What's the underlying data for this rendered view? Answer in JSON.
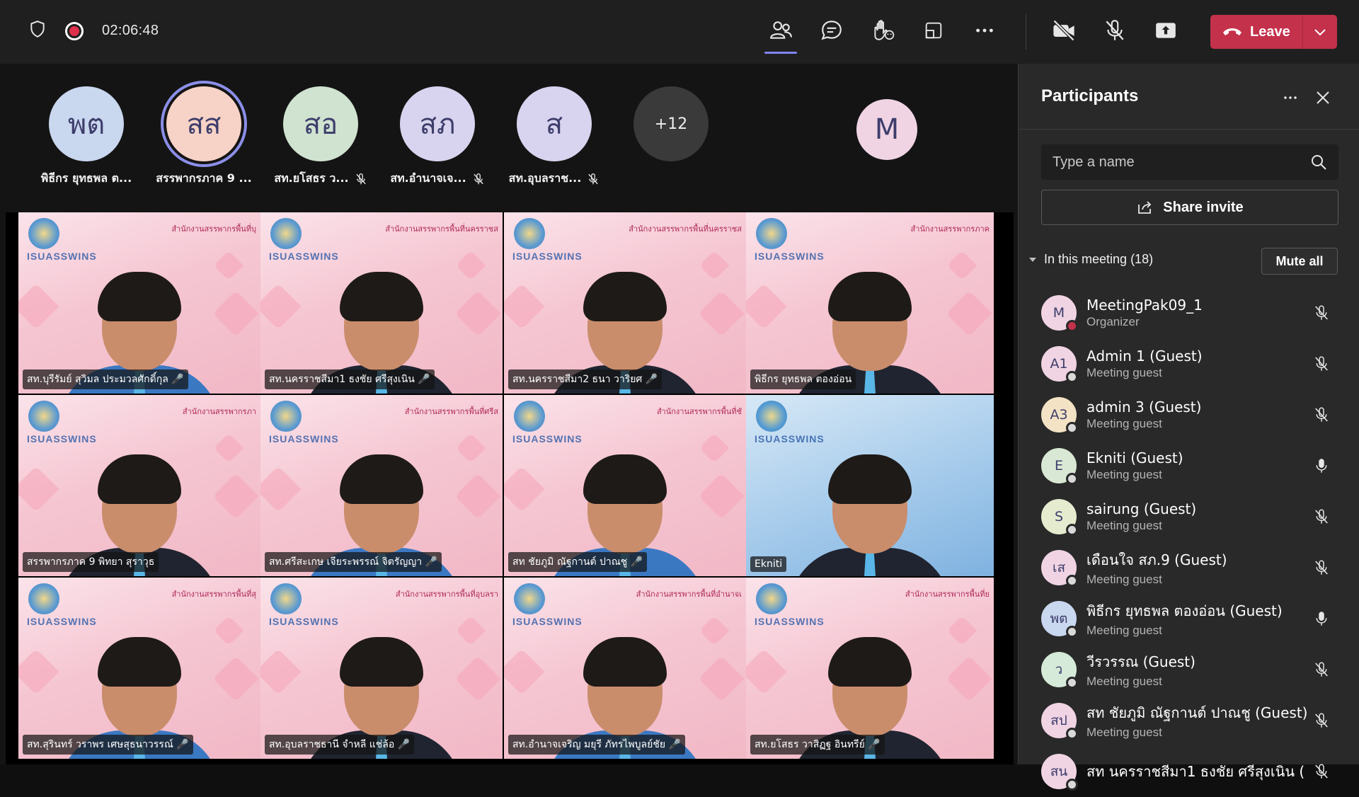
{
  "topbar": {
    "timer": "02:06:48",
    "leave_label": "Leave",
    "icons": [
      "shield-icon",
      "record-icon",
      "people-icon",
      "chat-icon",
      "raise-hand-icon",
      "share-tray-icon",
      "more-icon",
      "camera-off-icon",
      "mic-off-icon",
      "share-screen-icon"
    ]
  },
  "avatars": [
    {
      "initials": "พต",
      "name": "พิธีกร ยุทธพล ต...",
      "color": "#c9d7ef",
      "muted": false,
      "selected": false
    },
    {
      "initials": "สส",
      "name": "สรรพากรภาค 9 ...",
      "color": "#f7d2c6",
      "muted": false,
      "selected": true
    },
    {
      "initials": "สอ",
      "name": "สท.ยโสธร ว...",
      "color": "#cfe3d0",
      "muted": true,
      "selected": false
    },
    {
      "initials": "สภ",
      "name": "สท.อำนาจเจ...",
      "color": "#d8d4ef",
      "muted": true,
      "selected": false
    },
    {
      "initials": "ส",
      "name": "สท.อุบลราช...",
      "color": "#d8d4ef",
      "muted": true,
      "selected": false
    },
    {
      "initials": "+12",
      "name": "",
      "color": "#3a3a3a",
      "muted": false,
      "selected": false
    },
    {
      "initials": "M",
      "name": "",
      "color": "#f0d4e4",
      "muted": false,
      "selected": false
    }
  ],
  "tiles": [
    {
      "label": "สท.บุรีรัมย์ สุวิมล ประมวลศักดิ์กุล 🎤",
      "office": "สำนักงานสรรพากรพื้นที่บุ",
      "bg": "pink",
      "clothes": "blue"
    },
    {
      "label": "สท.นครราชสีมา1 ธงชัย ศรีสุงเนิน 🎤",
      "office": "สำนักงานสรรพากรพื้นที่นครราชส",
      "bg": "pink",
      "clothes": "dark"
    },
    {
      "label": "สท.นครราชสีมา2 ธนา วาริยศ 🎤",
      "office": "สำนักงานสรรพากรพื้นที่นครราชส",
      "bg": "pink",
      "clothes": "dark"
    },
    {
      "label": "พิธีกร ยุทธพล ตองอ่อน",
      "office": "สำนักงานสรรพากรภาค",
      "bg": "pink",
      "clothes": "dark"
    },
    {
      "label": "สรรพากรภาค 9 พิทยา สุราวุธ",
      "office": "สำนักงานสรรพากรภา",
      "bg": "pink",
      "clothes": "dark"
    },
    {
      "label": "สท.ศรีสะเกษ เจียระพรรณ์ จิตรัญญา 🎤",
      "office": "สำนักงานสรรพากรพื้นที่ศรีส",
      "bg": "pink",
      "clothes": "blue"
    },
    {
      "label": "สท ชัยภูมิ ณัฐกานต์ ปาณชู 🎤",
      "office": "สำนักงานสรรพากรพื้นที่ชั",
      "bg": "pink",
      "clothes": "blue"
    },
    {
      "label": "Ekniti",
      "office": "",
      "bg": "blue",
      "clothes": "dark"
    },
    {
      "label": "สท.สุรินทร์ วราพร เศษสุธนาวรรณ์ 🎤",
      "office": "สำนักงานสรรพากรพื้นที่สุ",
      "bg": "pink",
      "clothes": "blue"
    },
    {
      "label": "สท.อุบลราชธานี จำหลี แช่ล้อ 🎤",
      "office": "สำนักงานสรรพากรพื้นที่อุบลรา",
      "bg": "pink",
      "clothes": "dark"
    },
    {
      "label": "สท.อำนาจเจริญ มยุรี ภัทรไพบูลย์ชัย 🎤",
      "office": "สำนักงานสรรพากรพื้นที่อำนาจเ",
      "bg": "pink",
      "clothes": "blue"
    },
    {
      "label": "สท.ยโสธร วาสิฏฐ อินทรีย์ 🎤",
      "office": "สำนักงานสรรพากรพื้นที่ย",
      "bg": "pink",
      "clothes": "dark"
    }
  ],
  "brand_text": "ISUASSWINS",
  "panel": {
    "title": "Participants",
    "search_placeholder": "Type a name",
    "share_invite": "Share invite",
    "section_label": "In this meeting (18)",
    "mute_all": "Mute all",
    "participants": [
      {
        "initials": "M",
        "name": "MeetingPak09_1",
        "role": "Organizer",
        "color": "#f0d4e4",
        "presence": "busy",
        "mic": "off"
      },
      {
        "initials": "A1",
        "name": "Admin 1 (Guest)",
        "role": "Meeting guest",
        "color": "#f0d4e4",
        "presence": "away",
        "mic": "off"
      },
      {
        "initials": "A3",
        "name": "admin 3 (Guest)",
        "role": "Meeting guest",
        "color": "#f3e2c4",
        "presence": "away",
        "mic": "off"
      },
      {
        "initials": "E",
        "name": "Ekniti (Guest)",
        "role": "Meeting guest",
        "color": "#d9e8d4",
        "presence": "away",
        "mic": "on"
      },
      {
        "initials": "S",
        "name": "sairung (Guest)",
        "role": "Meeting guest",
        "color": "#e4ebcf",
        "presence": "away",
        "mic": "off"
      },
      {
        "initials": "เส",
        "name": "เดือนใจ สภ.9 (Guest)",
        "role": "Meeting guest",
        "color": "#f0d4e4",
        "presence": "away",
        "mic": "off"
      },
      {
        "initials": "พต",
        "name": "พิธีกร ยุทธพล ตองอ่อน (Guest)",
        "role": "Meeting guest",
        "color": "#c9d7ef",
        "presence": "away",
        "mic": "on"
      },
      {
        "initials": "ว",
        "name": "วีรวรรณ (Guest)",
        "role": "Meeting guest",
        "color": "#d6ead9",
        "presence": "away",
        "mic": "off"
      },
      {
        "initials": "สป",
        "name": "สท ชัยภูมิ ณัฐกานต์ ปาณชู (Guest)",
        "role": "Meeting guest",
        "color": "#f0d4e4",
        "presence": "away",
        "mic": "off"
      },
      {
        "initials": "สน",
        "name": "สท นครราชสีมา1 ธงชัย ศรีสุงเนิน (",
        "role": "",
        "color": "#f0d4e4",
        "presence": "away",
        "mic": "off"
      }
    ]
  }
}
